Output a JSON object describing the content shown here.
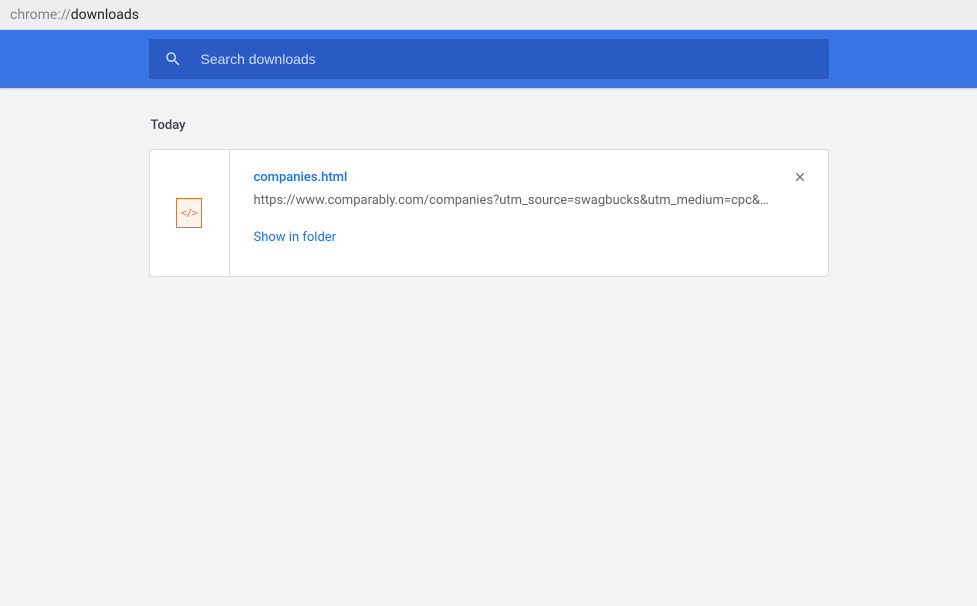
{
  "address": {
    "prefix": "chrome://",
    "path": "downloads"
  },
  "search": {
    "placeholder": "Search downloads",
    "value": ""
  },
  "section": {
    "header": "Today"
  },
  "download": {
    "icon_label": "</>",
    "file_name": "companies.html",
    "url": "https://www.comparably.com/companies?utm_source=swagbucks&utm_medium=cpc&…",
    "show_in_folder_label": "Show in folder"
  }
}
